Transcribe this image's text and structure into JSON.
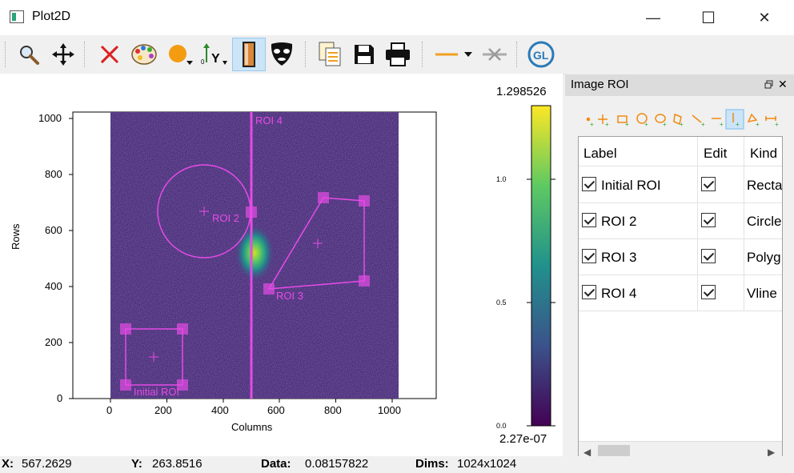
{
  "window": {
    "title": "Plot2D",
    "minimize": "—",
    "maximize": "☐",
    "close": "✕"
  },
  "toolbar": {
    "items": [
      "zoom-mode",
      "pan-mode",
      "reset-zoom",
      "colormap",
      "marker",
      "y-axis-inverted",
      "keep-aspect-ratio",
      "mask",
      "copy",
      "save",
      "print",
      "line-style",
      "remove-profile",
      "opengl"
    ]
  },
  "plot": {
    "x_label": "Columns",
    "y_label": "Rows",
    "x_ticks": [
      "0",
      "200",
      "400",
      "600",
      "800",
      "1000"
    ],
    "y_ticks": [
      "0",
      "200",
      "400",
      "600",
      "800",
      "1000"
    ],
    "rois": {
      "initial": "Initial ROI",
      "roi2": "ROI 2",
      "roi3": "ROI 3",
      "roi4": "ROI 4"
    },
    "roi_color": "#e64be6"
  },
  "colorbar": {
    "max_label": "1.298526",
    "min_label": "2.27e-07",
    "ticks": [
      "1.0",
      "0.5",
      "0.0"
    ]
  },
  "roi_panel": {
    "title": "Image ROI",
    "columns": [
      "Label",
      "Edit",
      "Kind"
    ],
    "rows": [
      {
        "label": "Initial ROI",
        "kind": "Rectar"
      },
      {
        "label": "ROI 2",
        "kind": "Circle"
      },
      {
        "label": "ROI 3",
        "kind": "Polyg"
      },
      {
        "label": "ROI 4",
        "kind": "Vline"
      }
    ]
  },
  "status": {
    "x_label": "X:",
    "x_value": "567.2629",
    "y_label": "Y:",
    "y_value": "263.8516",
    "data_label": "Data:",
    "data_value": "0.08157822",
    "dims_label": "Dims:",
    "dims_value": "1024x1024"
  }
}
